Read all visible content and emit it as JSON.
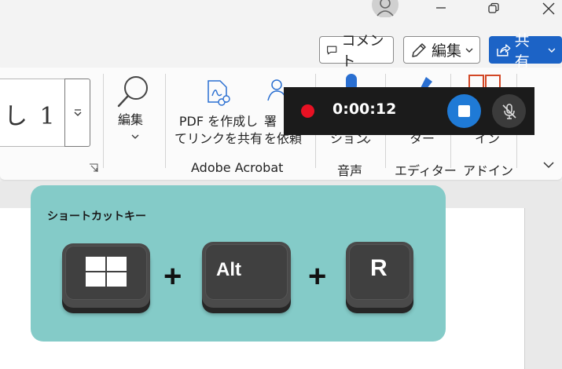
{
  "action_row": {
    "comment_label": "コメント",
    "edit_label": "編集",
    "share_label": "共有"
  },
  "ribbon": {
    "style_preview": "し 1",
    "find_label": "編集",
    "pdf_link_label_line1": "PDF を作成し",
    "pdf_link_label_line2": "てリンクを共有",
    "request_sign_line1": "署",
    "request_sign_line2": "を依頼",
    "dictation_partial": "ション",
    "editor_partial": "ター",
    "addins_partial": "イン",
    "group_adobe": "Adobe Acrobat",
    "group_voice": "音声",
    "group_editor": "エディター",
    "group_addins": "アドイン"
  },
  "recording": {
    "elapsed": "0:00:12"
  },
  "shortcut_card": {
    "title": "ショートカットキー",
    "key_alt": "Alt",
    "key_r": "R",
    "plus1": "+",
    "plus2": "+"
  },
  "colors": {
    "share_blue": "#1c63c6",
    "record_red": "#e81123",
    "stop_blue": "#1f7ad6",
    "card_teal": "#84cbc8"
  }
}
